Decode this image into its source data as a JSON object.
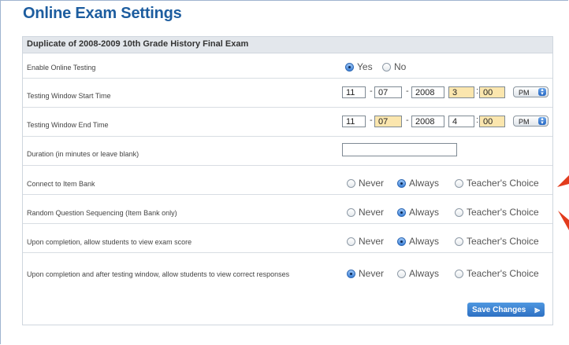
{
  "page": {
    "title": "Online Exam Settings"
  },
  "panel": {
    "title": "Duplicate of 2008-2009 10th Grade History Final Exam"
  },
  "enable_online": {
    "label": "Enable Online Testing",
    "options": [
      "Yes",
      "No"
    ],
    "selected": "Yes"
  },
  "start_time": {
    "label": "Testing Window Start Time",
    "month": "11",
    "day": "07",
    "year": "2008",
    "hour": "3",
    "minute": "00",
    "ampm": "PM",
    "sep_dash": "-",
    "sep_colon": ":"
  },
  "end_time": {
    "label": "Testing Window End Time",
    "month": "11",
    "day": "07",
    "year": "2008",
    "hour": "4",
    "minute": "00",
    "ampm": "PM"
  },
  "duration": {
    "label": "Duration (in minutes or leave blank)",
    "value": ""
  },
  "choice_options": [
    "Never",
    "Always",
    "Teacher's Choice"
  ],
  "item_bank": {
    "label": "Connect to Item Bank",
    "selected": "Always"
  },
  "random_seq": {
    "label": "Random Question Sequencing (Item Bank only)",
    "selected": "Always"
  },
  "view_score": {
    "label": "Upon completion, allow students to view exam score",
    "selected": "Always"
  },
  "view_responses": {
    "label": "Upon completion and after testing window, allow students to view correct responses",
    "selected": "Never"
  },
  "save_button": {
    "label": "Save Changes",
    "icon": "double-chevron-right-icon"
  },
  "colors": {
    "title_blue": "#1d5d9f",
    "highlight": "#fbe6ae",
    "button_blue": "#2d70c3",
    "annotation_red": "#e23b1c"
  }
}
